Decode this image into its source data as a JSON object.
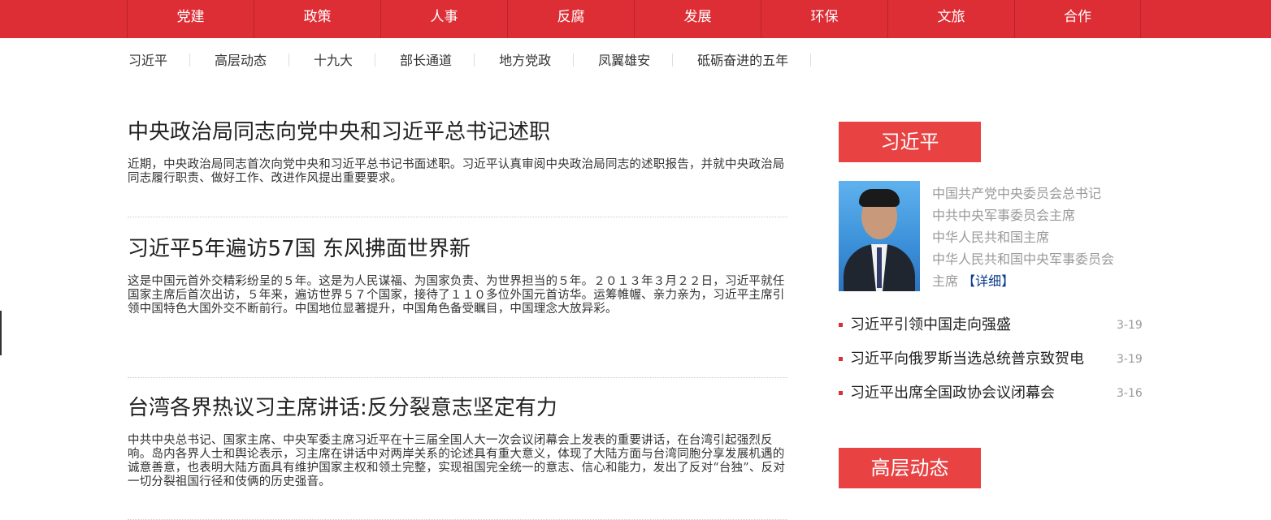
{
  "topnav": {
    "items": [
      "党建",
      "政策",
      "人事",
      "反腐",
      "发展",
      "环保",
      "文旅",
      "合作"
    ]
  },
  "subnav": {
    "items": [
      "习近平",
      "高层动态",
      "十九大",
      "部长通道",
      "地方党政",
      "凤翼雄安",
      "砥砺奋进的五年"
    ]
  },
  "articles": [
    {
      "title": "中央政治局同志向党中央和习近平总书记述职",
      "summary": "近期，中央政治局同志首次向党中央和习近平总书记书面述职。习近平认真审阅中央政治局同志的述职报告，并就中央政治局同志履行职责、做好工作、改进作风提出重要要求。"
    },
    {
      "title": "习近平5年遍访57国 东风拂面世界新",
      "summary": "这是中国元首外交精彩纷呈的５年。这是为人民谋福、为国家负责、为世界担当的５年。２０１３年３月２２日，习近平就任国家主席后首次出访，５年来，遍访世界５７个国家，接待了１１０多位外国元首访华。运筹帷幄、亲力亲为，习近平主席引领中国特色大国外交不断前行。中国地位显著提升，中国角色备受瞩目，中国理念大放异彩。"
    },
    {
      "title": "台湾各界热议习主席讲话:反分裂意志坚定有力",
      "summary": "中共中央总书记、国家主席、中央军委主席习近平在十三届全国人大一次会议闭幕会上发表的重要讲话，在台湾引起强烈反响。岛内各界人士和舆论表示，习主席在讲话中对两岸关系的论述具有重大意义，体现了大陆方面与台湾同胞分享发展机遇的诚意善意，也表明大陆方面具有维护国家主权和领土完整，实现祖国完全统一的意志、信心和能力，发出了反对“台独”、反对一切分裂祖国行径和伎俩的历史强音。"
    }
  ],
  "sidebar": {
    "section1": "习近平",
    "roles": [
      "中国共产党中央委员会总书记",
      "中共中央军事委员会主席",
      "中华人民共和国主席",
      "中华人民共和国中央军事委员会",
      "主席"
    ],
    "detail": "【详细】",
    "news": [
      {
        "title": "习近平引领中国走向强盛",
        "date": "3-19"
      },
      {
        "title": "习近平向俄罗斯当选总统普京致贺电",
        "date": "3-19"
      },
      {
        "title": "习近平出席全国政协会议闭幕会",
        "date": "3-16"
      }
    ],
    "section2": "高层动态"
  }
}
